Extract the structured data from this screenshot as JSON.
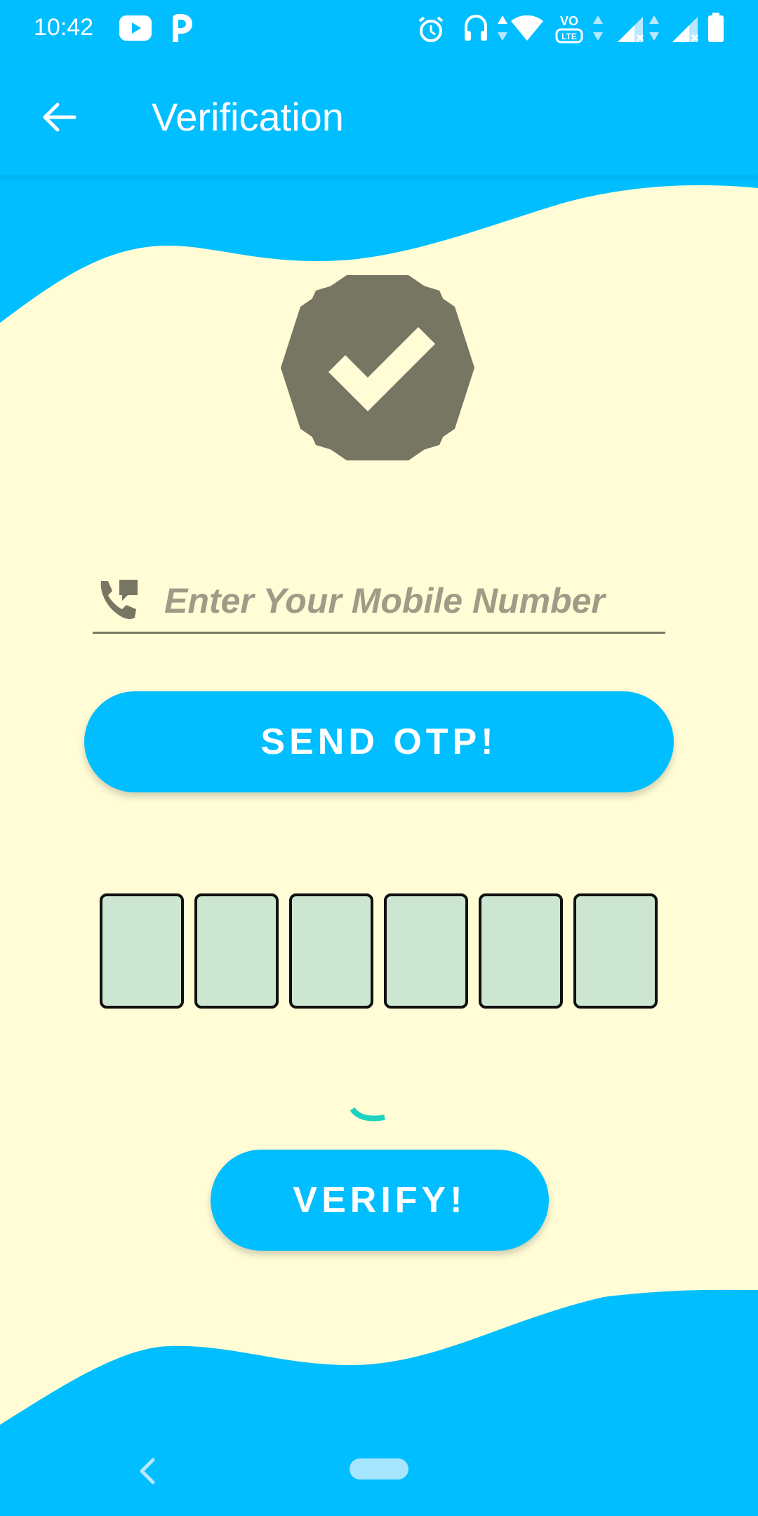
{
  "status_bar": {
    "time": "10:42",
    "icons": [
      "youtube-icon",
      "p-app-icon",
      "alarm-icon",
      "headset-icon",
      "data-arrows-icon",
      "wifi-icon",
      "volte-icon",
      "signal-sim1-icon",
      "signal-sim2-icon",
      "battery-icon"
    ],
    "volte_label": "VO\nLTE"
  },
  "app_bar": {
    "back_icon": "arrow-back-icon",
    "title": "Verification"
  },
  "badge": {
    "icon": "verified-badge-icon"
  },
  "phone": {
    "icon": "phone-forwarded-icon",
    "placeholder": "Enter Your Mobile Number",
    "value": ""
  },
  "send_otp": {
    "label": "SEND OTP!"
  },
  "otp": {
    "boxes": [
      "",
      "",
      "",
      "",
      "",
      ""
    ]
  },
  "verify": {
    "label": "VERIFY!"
  },
  "nav_bar": {
    "back_icon": "nav-back-icon",
    "home_icon": "home-pill-icon"
  },
  "colors": {
    "primary": "#00BEFF",
    "background": "#FFFCD6",
    "badge": "#767663",
    "otp_box": "#CDE6D2",
    "spinner": "#1DD3C0"
  }
}
